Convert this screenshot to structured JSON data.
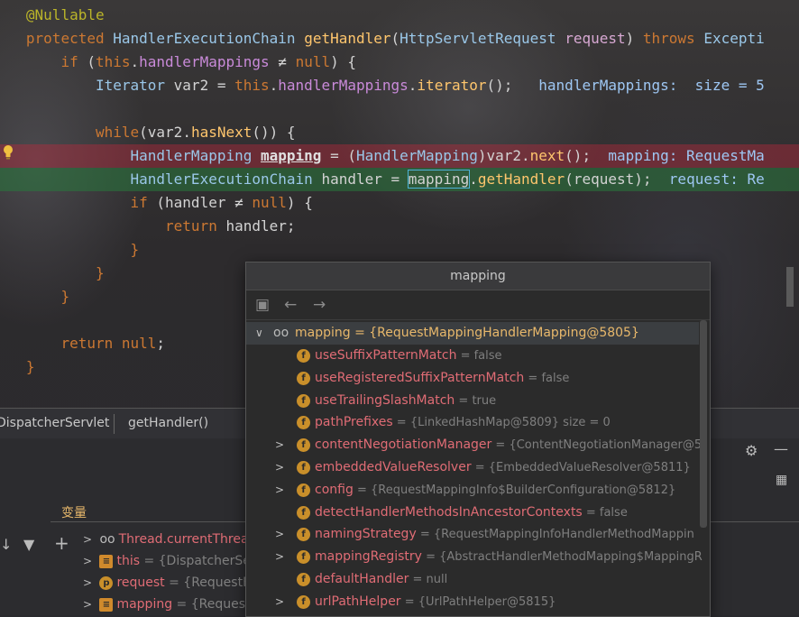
{
  "editor": {
    "lines": {
      "l1": {
        "annotation": "@Nullable"
      },
      "l2": {
        "kw": "protected",
        "type": "HandlerExecutionChain",
        "fn": "getHandler",
        "ptype": "HttpServletRequest",
        "param": "request",
        "throws": "throws",
        "exc": "Excepti"
      },
      "l3": {
        "kw": "if",
        "this": "this",
        "field": "handlerMappings",
        "ne": "≠",
        "null": "null"
      },
      "l4": {
        "type": "Iterator",
        "var": "var2",
        "this": "this",
        "field": "handlerMappings",
        "call": "iterator",
        "hint": "handlerMappings:  size = 5"
      },
      "l6": {
        "kw": "while",
        "var": "var2",
        "call": "hasNext"
      },
      "l7": {
        "type": "HandlerMapping",
        "var": "mapping",
        "cast": "HandlerMapping",
        "src": "var2",
        "call": "next",
        "hint": "mapping: RequestMa"
      },
      "l8": {
        "type": "HandlerExecutionChain",
        "var": "handler",
        "target": "mapping",
        "call": "getHandler",
        "arg": "request",
        "hint": "request: Re"
      },
      "l9": {
        "kw": "if",
        "var": "handler",
        "ne": "≠",
        "null": "null"
      },
      "l10": {
        "kw": "return",
        "var": "handler"
      },
      "l14": {
        "kw": "return",
        "null": "null"
      }
    }
  },
  "tabbar": {
    "tab1": "DispatcherServlet",
    "tab2": "getHandler()"
  },
  "panel": {
    "title": "变量",
    "vars": [
      {
        "name": "Thread.currentThrea",
        "val": ""
      },
      {
        "name": "this",
        "val": " = {DispatcherSe"
      },
      {
        "name": "request",
        "val": " = {RequestF"
      },
      {
        "name": "mapping",
        "val": " = {Reques"
      }
    ]
  },
  "popup": {
    "title": "mapping",
    "root": "mapping = {RequestMappingHandlerMapping@5805}",
    "rows": [
      {
        "name": "useSuffixPatternMatch",
        "val": " = false",
        "expand": false
      },
      {
        "name": "useRegisteredSuffixPatternMatch",
        "val": " = false",
        "expand": false
      },
      {
        "name": "useTrailingSlashMatch",
        "val": " = true",
        "expand": false
      },
      {
        "name": "pathPrefixes",
        "val": " = {LinkedHashMap@5809}  size = 0",
        "expand": false
      },
      {
        "name": "contentNegotiationManager",
        "val": " = {ContentNegotiationManager@5",
        "expand": true
      },
      {
        "name": "embeddedValueResolver",
        "val": " = {EmbeddedValueResolver@5811}",
        "expand": true
      },
      {
        "name": "config",
        "val": " = {RequestMappingInfo$BuilderConfiguration@5812}",
        "expand": true
      },
      {
        "name": "detectHandlerMethodsInAncestorContexts",
        "val": " = false",
        "expand": false
      },
      {
        "name": "namingStrategy",
        "val": " = {RequestMappingInfoHandlerMethodMappin",
        "expand": true
      },
      {
        "name": "mappingRegistry",
        "val": " = {AbstractHandlerMethodMapping$MappingR",
        "expand": true
      },
      {
        "name": "defaultHandler",
        "val": " = null",
        "expand": false
      },
      {
        "name": "urlPathHelper",
        "val": " = {UrlPathHelper@5815}",
        "expand": true
      }
    ]
  },
  "colors": {
    "breakpoint_line": "#7a2a36",
    "exec_line": "#2f6b3d",
    "keyword": "#cc7832",
    "function": "#ffc66d"
  }
}
